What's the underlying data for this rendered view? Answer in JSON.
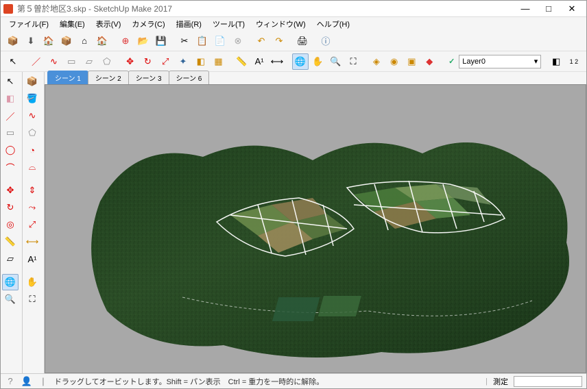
{
  "window": {
    "title": "第５曽於地区3.skp - SketchUp Make 2017",
    "min": "—",
    "max": "□",
    "close": "✕"
  },
  "menu": {
    "file": "ファイル(F)",
    "edit": "編集(E)",
    "view": "表示(V)",
    "camera": "カメラ(C)",
    "draw": "描画(R)",
    "tool": "ツール(T)",
    "window": "ウィンドウ(W)",
    "help": "ヘルプ(H)"
  },
  "layer": {
    "current": "Layer0",
    "chevron": "▾"
  },
  "scene_tabs": [
    "シーン 1",
    "シーン 2",
    "シーン 3",
    "シーン 6"
  ],
  "status": {
    "hint": "ドラッグしてオービットします。Shift = パン表示　Ctrl = 重力を一時的に解除。",
    "measure_label": "測定"
  },
  "icons": {
    "select": "↖",
    "eraser": "◧",
    "line": "／",
    "arc": "⌒",
    "rect": "▭",
    "circle": "◯",
    "curve": "∿",
    "poly": "⬠",
    "move": "✥",
    "rotate": "↻",
    "scale": "⤢",
    "pushpull": "⇕",
    "offset": "◎",
    "tape": "📏",
    "dim": "⟷",
    "text": "A",
    "paint": "🪣",
    "orbit": "🌐",
    "pan": "✋",
    "zoom": "🔍",
    "new": "📄",
    "open": "📂",
    "save": "💾",
    "cut": "✂",
    "copy": "📋",
    "paste": "📄",
    "undo": "↶",
    "redo": "↷",
    "print": "🖨",
    "warehouse": "🏬",
    "house": "🏠",
    "box": "📦"
  }
}
